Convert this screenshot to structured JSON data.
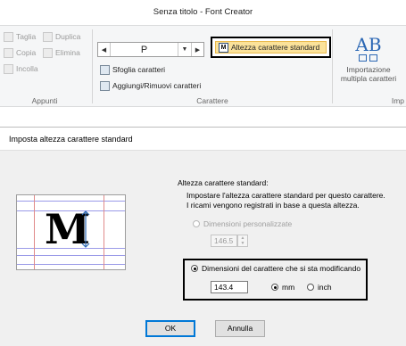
{
  "ribbon_window": {
    "title": "Senza titolo - Font Creator",
    "groups": {
      "appunti": {
        "label": "Appunti",
        "taglia": "Taglia",
        "duplica": "Duplica",
        "copia": "Copia",
        "elimina": "Elimina",
        "incolla": "Incolla"
      },
      "carattere": {
        "label": "Carattere",
        "current_char": "P",
        "sfoglia": "Sfoglia caratteri",
        "aggiungi": "Aggiungi/Rimuovi caratteri",
        "altezza_standard": "Altezza carattere standard"
      },
      "importa": {
        "label": "Imp",
        "button_line1": "Importazione",
        "button_line2": "multipla caratteri",
        "icon_text": "AB"
      }
    }
  },
  "dialog": {
    "title": "Imposta altezza carattere standard",
    "section_label": "Altezza carattere standard:",
    "description_line1": "Impostare l'altezza carattere standard per questo carattere.",
    "description_line2": "I ricami vengono registrati in base a questa altezza.",
    "preview_char": "M",
    "option_custom": "Dimensioni personalizzate",
    "custom_value": "146.5",
    "option_current": "Dimensioni del carattere che si sta modificando",
    "current_value": "143.4",
    "unit_mm": "mm",
    "unit_inch": "inch",
    "ok_label": "OK",
    "cancel_label": "Annulla",
    "selected_option": "current",
    "selected_unit": "mm"
  },
  "colors": {
    "highlight": "#fbe29a",
    "accent": "#2b67b4",
    "guide_blue": "#6f6fe0",
    "guide_red": "#e08a8a"
  }
}
